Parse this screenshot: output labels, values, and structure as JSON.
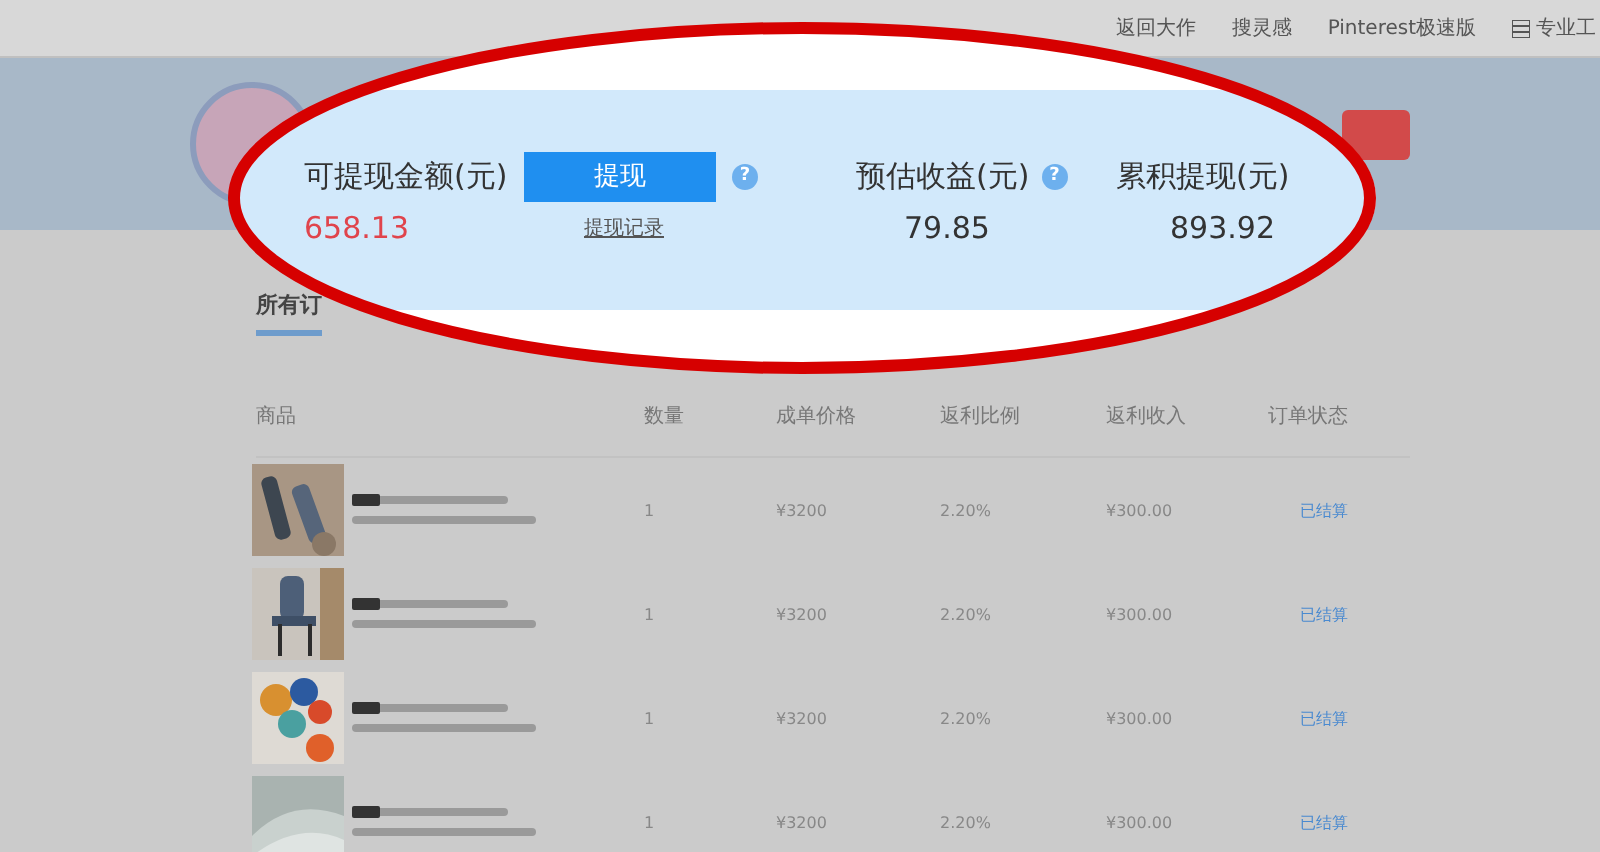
{
  "nav": {
    "links": [
      "返回大作",
      "搜灵感",
      "Pinterest极速版"
    ],
    "tool_link": "专业工"
  },
  "tabs": [
    {
      "label": "所有订",
      "selected": true
    }
  ],
  "table": {
    "columns": [
      "商品",
      "数量",
      "成单价格",
      "返利比例",
      "返利收入",
      "订单状态"
    ],
    "rows": [
      {
        "quantity": "1",
        "price": "¥3200",
        "ratio": "2.20%",
        "income": "¥300.00",
        "status": "已结算"
      },
      {
        "quantity": "1",
        "price": "¥3200",
        "ratio": "2.20%",
        "income": "¥300.00",
        "status": "已结算"
      },
      {
        "quantity": "1",
        "price": "¥3200",
        "ratio": "2.20%",
        "income": "¥300.00",
        "status": "已结算"
      },
      {
        "quantity": "1",
        "price": "¥3200",
        "ratio": "2.20%",
        "income": "¥300.00",
        "status": "已结算"
      }
    ]
  },
  "earnings": {
    "withdrawable": {
      "label": "可提现金额(元)",
      "value": "658.13"
    },
    "withdraw_button": "提现",
    "help": "?",
    "history_link": "提现记录",
    "estimated": {
      "label": "预估收益(元)",
      "value": "79.85",
      "help": "?"
    },
    "total": {
      "label": "累积提现(元)",
      "value": "893.92"
    }
  }
}
